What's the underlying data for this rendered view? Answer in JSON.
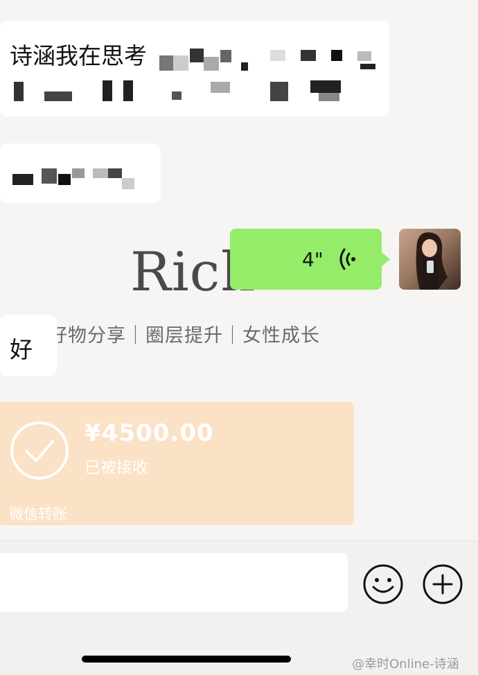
{
  "background": {
    "title": "Rich",
    "tagline": "好物分享｜圈层提升｜女性成长"
  },
  "messages": [
    {
      "side": "left",
      "type": "text",
      "text": "诗涵我在思考"
    },
    {
      "side": "left",
      "type": "text",
      "text": ""
    },
    {
      "side": "right",
      "type": "voice",
      "duration": "4\""
    },
    {
      "side": "left",
      "type": "text",
      "text": "好"
    }
  ],
  "transfer": {
    "amount": "¥4500.00",
    "status": "已被接收",
    "label": "微信转账"
  },
  "input_bar": {
    "placeholder": "",
    "emoji_icon": "emoji-smile-icon",
    "plus_icon": "plus-circle-icon"
  },
  "watermark": {
    "credit": "@幸时Online-诗涵"
  },
  "colors": {
    "voice_bubble": "#95ec69",
    "transfer_card": "#fbe1c6",
    "chat_background": "#f7f5f4"
  }
}
